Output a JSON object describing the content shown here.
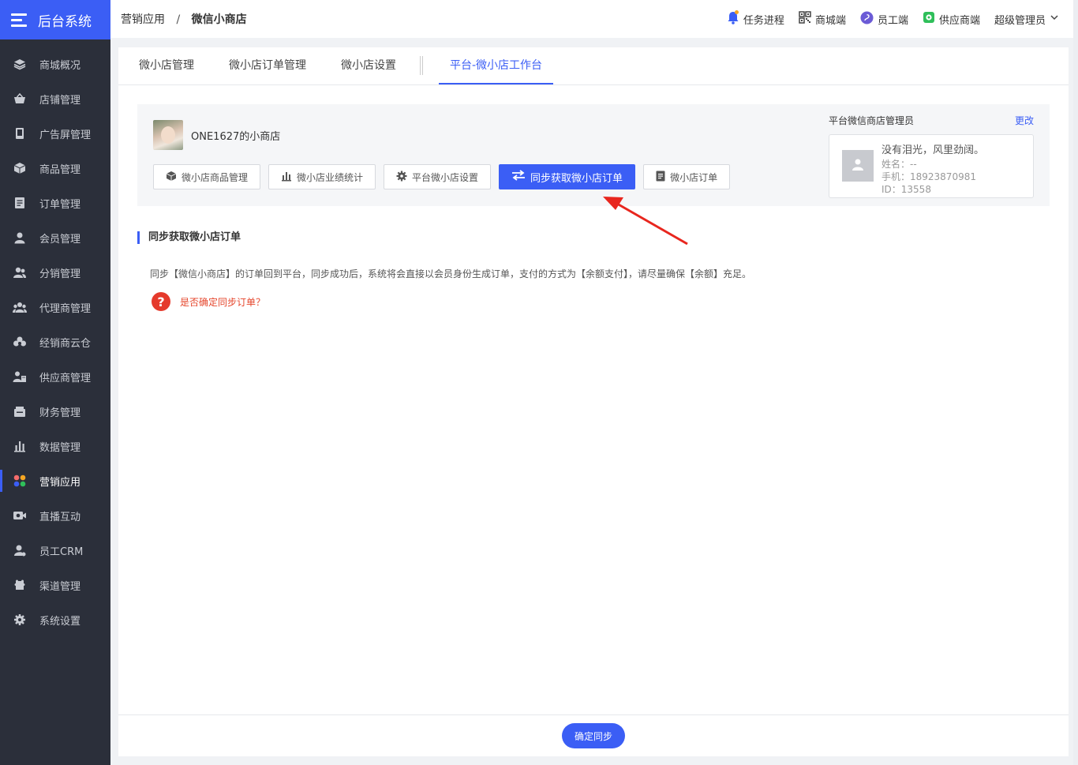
{
  "app": {
    "title": "后台系统"
  },
  "sidebar": {
    "items": [
      {
        "label": "商城概况",
        "icon": "layers-icon"
      },
      {
        "label": "店铺管理",
        "icon": "basket-icon"
      },
      {
        "label": "广告屏管理",
        "icon": "phone-icon"
      },
      {
        "label": "商品管理",
        "icon": "box-icon"
      },
      {
        "label": "订单管理",
        "icon": "document-icon"
      },
      {
        "label": "会员管理",
        "icon": "user-icon"
      },
      {
        "label": "分销管理",
        "icon": "users-icon"
      },
      {
        "label": "代理商管理",
        "icon": "group-icon"
      },
      {
        "label": "经销商云仓",
        "icon": "cloud-icon"
      },
      {
        "label": "供应商管理",
        "icon": "supplier-icon"
      },
      {
        "label": "财务管理",
        "icon": "wallet-icon"
      },
      {
        "label": "数据管理",
        "icon": "bar-chart-icon"
      },
      {
        "label": "营销应用",
        "icon": "apps-icon",
        "active": true
      },
      {
        "label": "直播互动",
        "icon": "video-icon"
      },
      {
        "label": "员工CRM",
        "icon": "crm-icon"
      },
      {
        "label": "渠道管理",
        "icon": "channel-icon"
      },
      {
        "label": "系统设置",
        "icon": "gear-icon"
      }
    ]
  },
  "header": {
    "breadcrumb": {
      "parent": "营销应用",
      "separator": "/",
      "current": "微信小商店"
    },
    "task_progress": "任务进程",
    "mall_end": "商城端",
    "staff_end": "员工端",
    "supplier_end": "供应商端",
    "user": "超级管理员"
  },
  "tabs": [
    {
      "label": "微小店管理"
    },
    {
      "label": "微小店订单管理"
    },
    {
      "label": "微小店设置"
    },
    {
      "label": "平台-微小店工作台",
      "active": true
    }
  ],
  "shop": {
    "name": "ONE1627的小商店",
    "buttons": {
      "goods": "微小店商品管理",
      "stats": "微小店业绩统计",
      "settings": "平台微小店设置",
      "sync": "同步获取微小店订单",
      "orders": "微小店订单"
    }
  },
  "admin": {
    "title": "平台微信商店管理员",
    "edit": "更改",
    "nickname": "没有泪光，风里劲阔。",
    "name": "姓名：--",
    "phone": "手机：18923870981",
    "id": "ID：13558"
  },
  "section": {
    "title": "同步获取微小店订单",
    "description": "同步【微信小商店】的订单回到平台，同步成功后，系统将会直接以会员身份生成订单，支付的方式为【余额支付】，请尽量确保【余额】充足。",
    "question": "是否确定同步订单？"
  },
  "footer": {
    "confirm": "确定同步"
  },
  "colors": {
    "primary": "#3b5ef5",
    "sidebar": "#2b2f3a",
    "danger": "#e53a2c"
  }
}
